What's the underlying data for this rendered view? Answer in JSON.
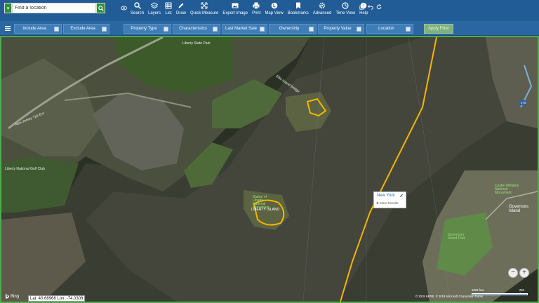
{
  "search": {
    "placeholder": "Find a location"
  },
  "toolbar": {
    "items": [
      {
        "label": "Search",
        "icon": "search-icon"
      },
      {
        "label": "Layers",
        "icon": "layers-icon"
      },
      {
        "label": "List",
        "icon": "list-icon"
      },
      {
        "label": "Draw",
        "icon": "pencil-icon"
      },
      {
        "label": "Quick Measure",
        "icon": "measure-icon"
      },
      {
        "label": "Export Image",
        "icon": "image-icon"
      },
      {
        "label": "Print",
        "icon": "print-icon"
      },
      {
        "label": "Map View",
        "icon": "globe-icon"
      },
      {
        "label": "Bookmarks",
        "icon": "bookmark-icon"
      },
      {
        "label": "Advanced",
        "icon": "gear-icon"
      },
      {
        "label": "Time View",
        "icon": "clock-icon"
      },
      {
        "label": "Help",
        "icon": "help-icon"
      }
    ]
  },
  "filters": {
    "include_area": "Include Area",
    "exclude_area": "Exclude Area",
    "property_type": "Property Type",
    "characteristics": "Characteristics",
    "last_market_sale": "Last Market Sale",
    "ownership": "Ownership",
    "property_value": "Property Value",
    "location": "Location",
    "apply": "Apply Filter"
  },
  "map": {
    "labels": {
      "liberty_state_park": "Liberty State Park",
      "liberty_national": "Liberty National Golf Club",
      "nj_tpk": "New Jersey Tpk Ext",
      "ellis_bridge": "Ellis Island Bridge",
      "statue": "Statue of Liberty National Monument",
      "liberty_island": "LIBERTY ISLAND",
      "governors_island": "Governors Island",
      "castle_williams": "Castle Williams National Monument",
      "governors_park": "Governors Island Park",
      "route_278": "278"
    },
    "popup": {
      "title": "New York",
      "more": "More Results"
    },
    "zoom_out": "−",
    "zoom_in": "+",
    "bing": "Bing",
    "coords": "Lat: 40.68968 Lon: -74.0308",
    "copyright": "© 2018 HERE, © 2018 Microsoft Corporation Terms",
    "scale_feet": "1000 feet",
    "scale_m": "250 m"
  },
  "colors": {
    "toolbar_bg": "#215c96",
    "filter_bg": "#2a67a2",
    "accent_green": "#2f8f3a",
    "border_yellow": "#f5b400"
  }
}
